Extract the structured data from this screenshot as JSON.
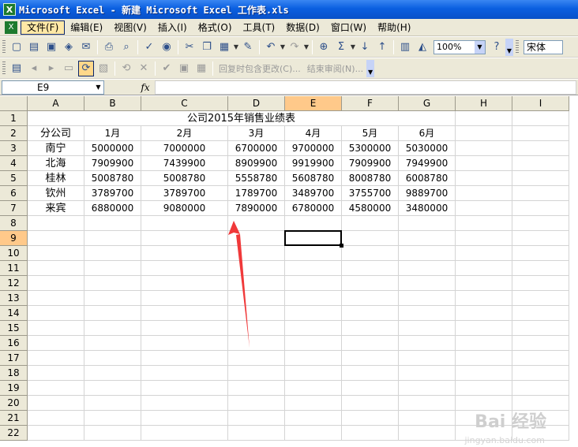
{
  "window": {
    "title": "Microsoft Excel - 新建 Microsoft Excel 工作表.xls",
    "app_icon": "X"
  },
  "menu": {
    "items": [
      "文件(F)",
      "编辑(E)",
      "视图(V)",
      "插入(I)",
      "格式(O)",
      "工具(T)",
      "数据(D)",
      "窗口(W)",
      "帮助(H)"
    ],
    "active_index": 0
  },
  "toolbar": {
    "zoom": "100%",
    "font": "宋体",
    "review_reply": "回复时包含更改(C)...",
    "review_end": "结束审阅(N)..."
  },
  "formula_bar": {
    "name_box": "E9",
    "fx_label": "fx",
    "formula": ""
  },
  "sheet": {
    "columns": [
      "A",
      "B",
      "C",
      "D",
      "E",
      "F",
      "G",
      "H",
      "I"
    ],
    "selected_column": "E",
    "row_numbers": [
      "1",
      "2",
      "3",
      "4",
      "5",
      "6",
      "7",
      "8",
      "9",
      "10",
      "11",
      "12",
      "13",
      "14",
      "15",
      "16",
      "17",
      "18",
      "19",
      "20",
      "21",
      "22"
    ],
    "selected_row": "9",
    "active_cell": "E9",
    "title": "公司2015年销售业绩表",
    "header": [
      "分公司",
      "1月",
      "2月",
      "3月",
      "4月",
      "5月",
      "6月"
    ],
    "rows": [
      [
        "南宁",
        "5000000",
        "7000000",
        "6700000",
        "9700000",
        "5300000",
        "5030000"
      ],
      [
        "北海",
        "7909900",
        "7439900",
        "8909900",
        "9919900",
        "7909900",
        "7949900"
      ],
      [
        "桂林",
        "5008780",
        "5008780",
        "5558780",
        "5608780",
        "8008780",
        "6008780"
      ],
      [
        "钦州",
        "3789700",
        "3789700",
        "1789700",
        "3489700",
        "3755700",
        "9889700"
      ],
      [
        "来宾",
        "6880000",
        "9080000",
        "7890000",
        "6780000",
        "4580000",
        "3480000"
      ]
    ]
  },
  "annotation": {
    "color": "#f0393a",
    "type": "arrow-pointing-up"
  },
  "watermark": {
    "text": "Bai 经验",
    "sub": "jingyan.baidu.com"
  }
}
